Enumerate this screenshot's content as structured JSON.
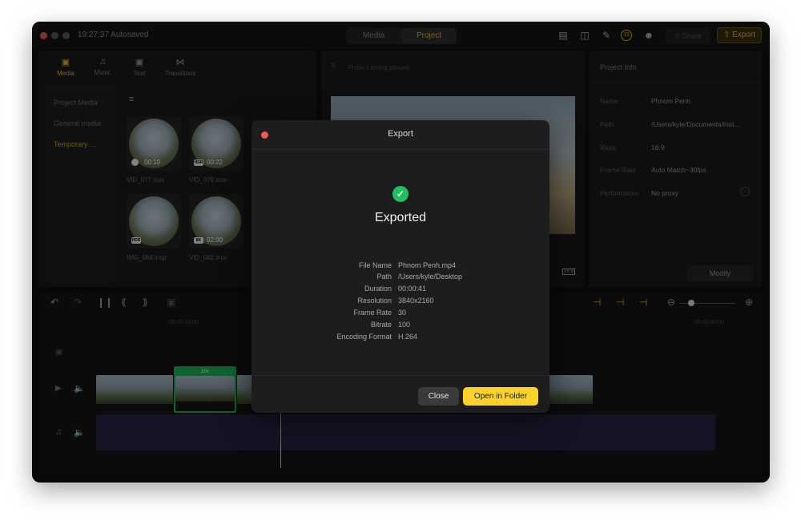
{
  "titlebar": {
    "autosave": "19:27:37 Autosaved",
    "mode_tabs": [
      {
        "label": "Media"
      },
      {
        "label": "Project"
      }
    ],
    "share_label": "Share",
    "export_label": "Export"
  },
  "media_panel": {
    "tabs": [
      {
        "label": "Media",
        "icon": "folder-icon"
      },
      {
        "label": "Music",
        "icon": "music-note-icon"
      },
      {
        "label": "Text",
        "icon": "text-icon"
      },
      {
        "label": "Transitions",
        "icon": "transitions-icon"
      }
    ],
    "sidebar": [
      "Project Media",
      "General media",
      "Temporary ..."
    ],
    "items": [
      {
        "name": "VID_077.insv",
        "duration": "00:10",
        "badge": ""
      },
      {
        "name": "VID_079.insv",
        "duration": "00:22",
        "badge": "HDR"
      },
      {
        "name": "IMG_084.insp",
        "duration": "",
        "badge": "HDR"
      },
      {
        "name": "VID_082.insv",
        "duration": "02:00",
        "badge": "8K"
      }
    ]
  },
  "player": {
    "placeholder": "Project being played",
    "aspect": "16:9"
  },
  "project_info": {
    "title": "Project Info",
    "rows": [
      {
        "label": "Name",
        "value": "Phnom Penh"
      },
      {
        "label": "Path",
        "value": "/Users/kyle/Documents/Inst..."
      },
      {
        "label": "Ratio",
        "value": "16:9"
      },
      {
        "label": "Frame Rate",
        "value": "Auto Match~30fps"
      },
      {
        "label": "Performance",
        "value": "No proxy"
      }
    ],
    "modify_label": "Modify"
  },
  "timeline": {
    "ruler": [
      "00:00:10:00",
      "00:00:40:00"
    ],
    "speed_label": "10x"
  },
  "export_dialog": {
    "title": "Export",
    "status": "Exported",
    "details": [
      {
        "label": "File Name",
        "value": "Phnom Penh.mp4"
      },
      {
        "label": "Path",
        "value": "/Users/kyle/Desktop"
      },
      {
        "label": "Duration",
        "value": "00:00:41"
      },
      {
        "label": "Resolution",
        "value": "3840x2160"
      },
      {
        "label": "Frame Rate",
        "value": "30"
      },
      {
        "label": "Bitrate",
        "value": "100"
      },
      {
        "label": "Encoding Format",
        "value": "H.264"
      }
    ],
    "close_label": "Close",
    "open_label": "Open in Folder"
  },
  "colors": {
    "accent": "#fcd12a",
    "success": "#1fc05d",
    "audio_track": "#2a2446",
    "speed_clip": "#1fb25a"
  }
}
